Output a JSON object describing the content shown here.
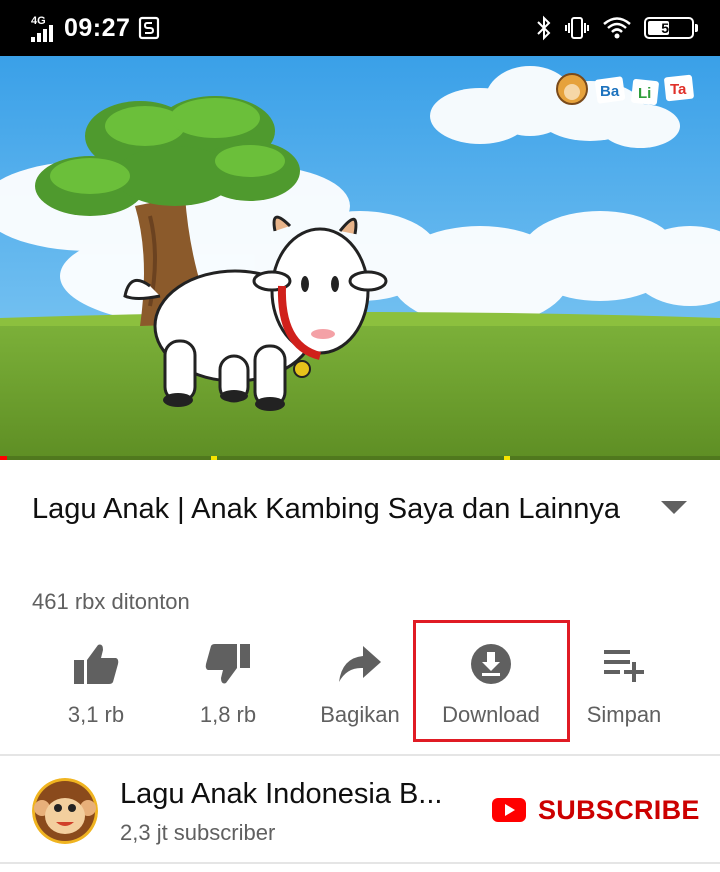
{
  "status_bar": {
    "network": "4G",
    "time": "09:27",
    "battery": "55"
  },
  "video": {
    "progress_fraction": 0.01,
    "ad_markers_fraction": [
      0.293,
      0.7
    ],
    "logo_letters": [
      "Ba",
      "Li",
      "Ta"
    ]
  },
  "title": "Lagu Anak | Anak Kambing Saya dan Lainnya",
  "views": "461 rbx ditonton",
  "actions": {
    "like": {
      "label": "3,1 rb",
      "icon": "thumb-up-icon"
    },
    "dislike": {
      "label": "1,8 rb",
      "icon": "thumb-down-icon"
    },
    "share": {
      "label": "Bagikan",
      "icon": "share-icon"
    },
    "download": {
      "label": "Download",
      "icon": "download-icon"
    },
    "save": {
      "label": "Simpan",
      "icon": "playlist-add-icon"
    }
  },
  "channel": {
    "name": "Lagu Anak Indonesia B...",
    "subscribers": "2,3 jt subscriber",
    "subscribe_label": "SUBSCRIBE"
  },
  "colors": {
    "accent_red": "#cc0000",
    "highlight_box": "#e01b24",
    "secondary_text": "#606060"
  }
}
